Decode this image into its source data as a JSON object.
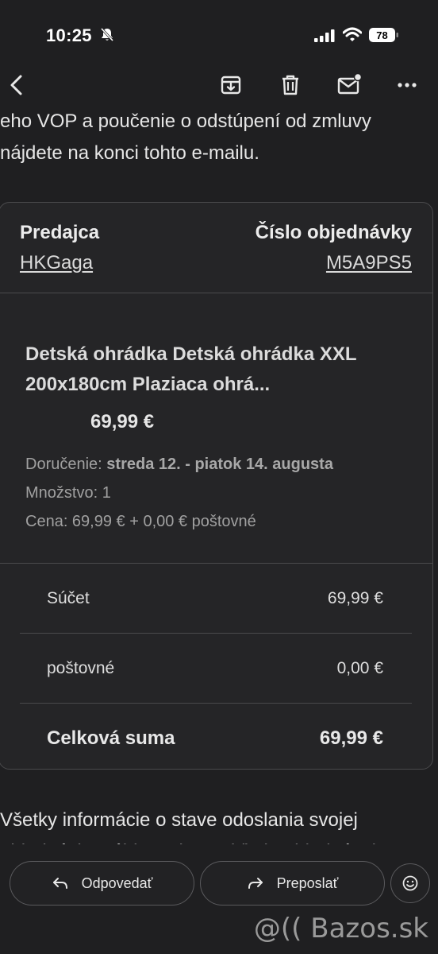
{
  "status_bar": {
    "time": "10:25",
    "battery": "78"
  },
  "email_intro": {
    "line1": "eho VOP a poučenie o odstúpení od zmluvy",
    "line2": "nájdete na konci tohto e-mailu."
  },
  "order": {
    "seller_label": "Predajca",
    "seller_value": "HKGaga",
    "order_no_label": "Číslo objednávky",
    "order_no_value": "M5A9PS5",
    "product_title": "Detská ohrádka Detská ohrádka XXL 200x180cm Plaziaca ohrá...",
    "product_price": "69,99 €",
    "delivery_label": "Doručenie:",
    "delivery_value": "streda 12. - piatok 14. augusta",
    "quantity": "Množstvo: 1",
    "price_line": "Cena: 69,99 € + 0,00 € poštovné",
    "summary": [
      {
        "label": "Súčet",
        "value": "69,99 €"
      },
      {
        "label": "poštovné",
        "value": "0,00 €"
      }
    ],
    "total_label": "Celková suma",
    "total_value": "69,99 €"
  },
  "email_after": {
    "line1": "Všetky informácie o stave odoslania svojej",
    "line2": "objednávky nájdete si v prehľade objednávok"
  },
  "actions": {
    "reply": "Odpovedať",
    "forward": "Preposlať"
  },
  "watermark": "@(( Bazos.sk",
  "colors": {
    "background": "#1f1f21",
    "card": "#252527",
    "border": "#4a4a4c"
  },
  "icons": [
    "back-arrow-icon",
    "archive-icon",
    "trash-icon",
    "mark-unread-icon",
    "more-icon",
    "reply-icon",
    "forward-icon",
    "emoji-icon"
  ]
}
